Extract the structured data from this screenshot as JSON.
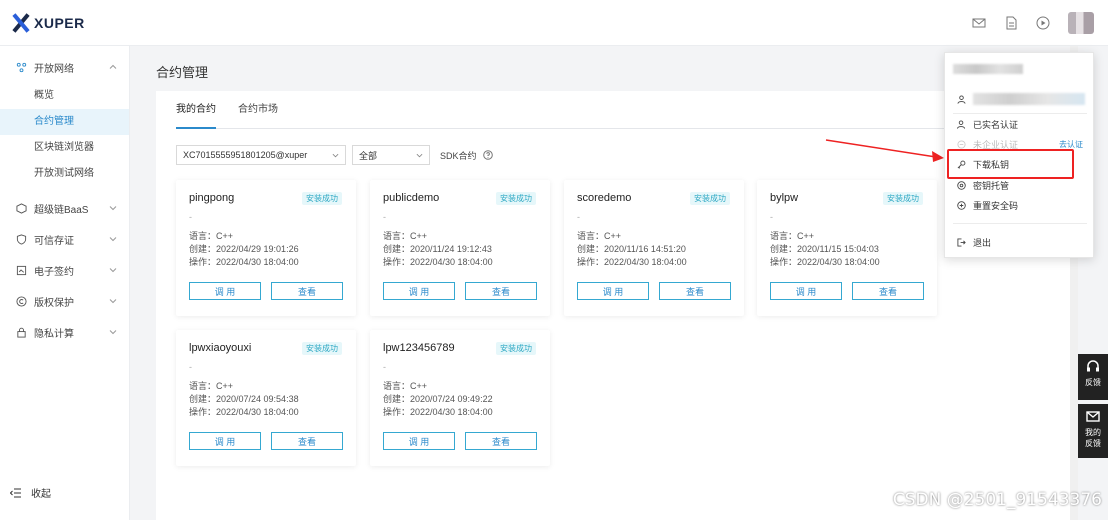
{
  "brand": {
    "name": "XUPER"
  },
  "sidebar": {
    "groups": [
      {
        "label": "开放网络",
        "icon": "network-icon",
        "expanded": true,
        "children": [
          "概览",
          "合约管理",
          "区块链浏览器",
          "开放测试网络"
        ]
      },
      {
        "label": "超级链BaaS",
        "icon": "cube-icon"
      },
      {
        "label": "可信存证",
        "icon": "shield-icon"
      },
      {
        "label": "电子签约",
        "icon": "sign-icon"
      },
      {
        "label": "版权保护",
        "icon": "copyright-icon"
      },
      {
        "label": "隐私计算",
        "icon": "lock-icon"
      }
    ],
    "active_child": "合约管理",
    "collapse_label": "收起"
  },
  "page": {
    "title": "合约管理",
    "tabs": [
      "我的合约",
      "合约市场"
    ],
    "active_tab": "我的合约",
    "filters": {
      "account": "XC7015555951801205@xuper",
      "status": "全部",
      "sdk_label": "SDK合约"
    }
  },
  "cards": [
    {
      "name": "pingpong",
      "badge": "安装成功",
      "dash": "-",
      "lang": "语言：C++",
      "created": "创建：2022/04/29 19:01:26",
      "op": "操作：2022/04/30 18:04:00",
      "call": "调 用",
      "view": "查看"
    },
    {
      "name": "publicdemo",
      "badge": "安装成功",
      "dash": "-",
      "lang": "语言：C++",
      "created": "创建：2020/11/24 19:12:43",
      "op": "操作：2022/04/30 18:04:00",
      "call": "调 用",
      "view": "查看"
    },
    {
      "name": "scoredemo",
      "badge": "安装成功",
      "dash": "-",
      "lang": "语言：C++",
      "created": "创建：2020/11/16 14:51:20",
      "op": "操作：2022/04/30 18:04:00",
      "call": "调 用",
      "view": "查看"
    },
    {
      "name": "bylpw",
      "badge": "安装成功",
      "dash": "-",
      "lang": "语言：C++",
      "created": "创建：2020/11/15 15:04:03",
      "op": "操作：2022/04/30 18:04:00",
      "call": "调 用",
      "view": "查看"
    },
    {
      "name": "lpwxiaoyouxi",
      "badge": "安装成功",
      "dash": "-",
      "lang": "语言：C++",
      "created": "创建：2020/07/24 09:54:38",
      "op": "操作：2022/04/30 18:04:00",
      "call": "调 用",
      "view": "查看"
    },
    {
      "name": "lpw123456789",
      "badge": "安装成功",
      "dash": "-",
      "lang": "语言：C++",
      "created": "创建：2020/07/24 09:49:22",
      "op": "操作：2022/04/30 18:04:00",
      "call": "调 用",
      "view": "查看"
    }
  ],
  "user_menu": {
    "verified": "已实名认证",
    "enterprise": "未企业认证",
    "enterprise_link": "去认证",
    "download_key": "下载私钥",
    "key_custody": "密钥托管",
    "reset_password": "重置安全码",
    "logout": "退出"
  },
  "feedback": {
    "label1": "反馈",
    "label2": "我的反馈"
  },
  "watermark": "CSDN @2501_91543376",
  "colors": {
    "accent": "#2b8acb",
    "highlight": "#e22222",
    "badge_bg": "#e6f7fa"
  }
}
